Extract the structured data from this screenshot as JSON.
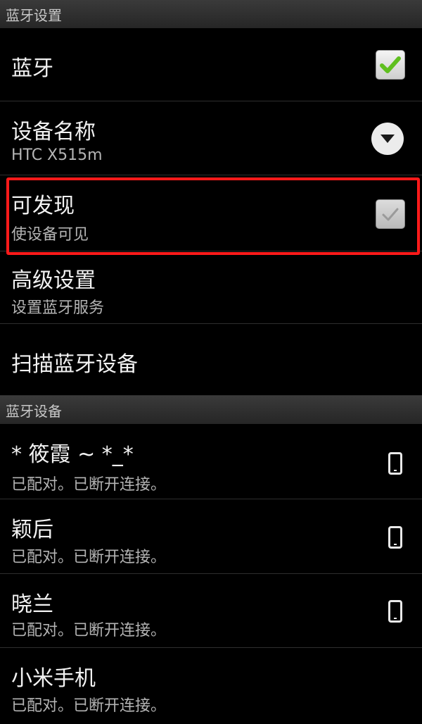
{
  "section_bluetooth_settings": {
    "title": "蓝牙设置"
  },
  "settings": {
    "bluetooth": {
      "title": "蓝牙",
      "checked": true,
      "control_icon": "check-icon"
    },
    "device_name": {
      "title": "设备名称",
      "value": "HTC X515m",
      "control_icon": "chevron-down-icon"
    },
    "discoverable": {
      "title": "可发现",
      "subtitle": "使设备可见",
      "checked": true,
      "enabled": false,
      "control_icon": "check-icon"
    },
    "advanced": {
      "title": "高级设置",
      "subtitle": "设置蓝牙服务"
    },
    "scan": {
      "title": "扫描蓝牙设备"
    }
  },
  "section_devices": {
    "title": "蓝牙设备"
  },
  "devices": [
    {
      "name": "* 筱霞 ~ *_*",
      "status": "已配对。已断开连接。",
      "icon": "phone-icon"
    },
    {
      "name": "颖后",
      "status": "已配对。已断开连接。",
      "icon": "phone-icon"
    },
    {
      "name": "晓兰",
      "status": "已配对。已断开连接。",
      "icon": "phone-icon"
    },
    {
      "name": "小米手机",
      "status": "已配对。已断开连接。",
      "icon": "phone-icon"
    }
  ],
  "colors": {
    "highlight": "#ff1a1a",
    "check": "#5fbf1f",
    "background": "#000000"
  }
}
